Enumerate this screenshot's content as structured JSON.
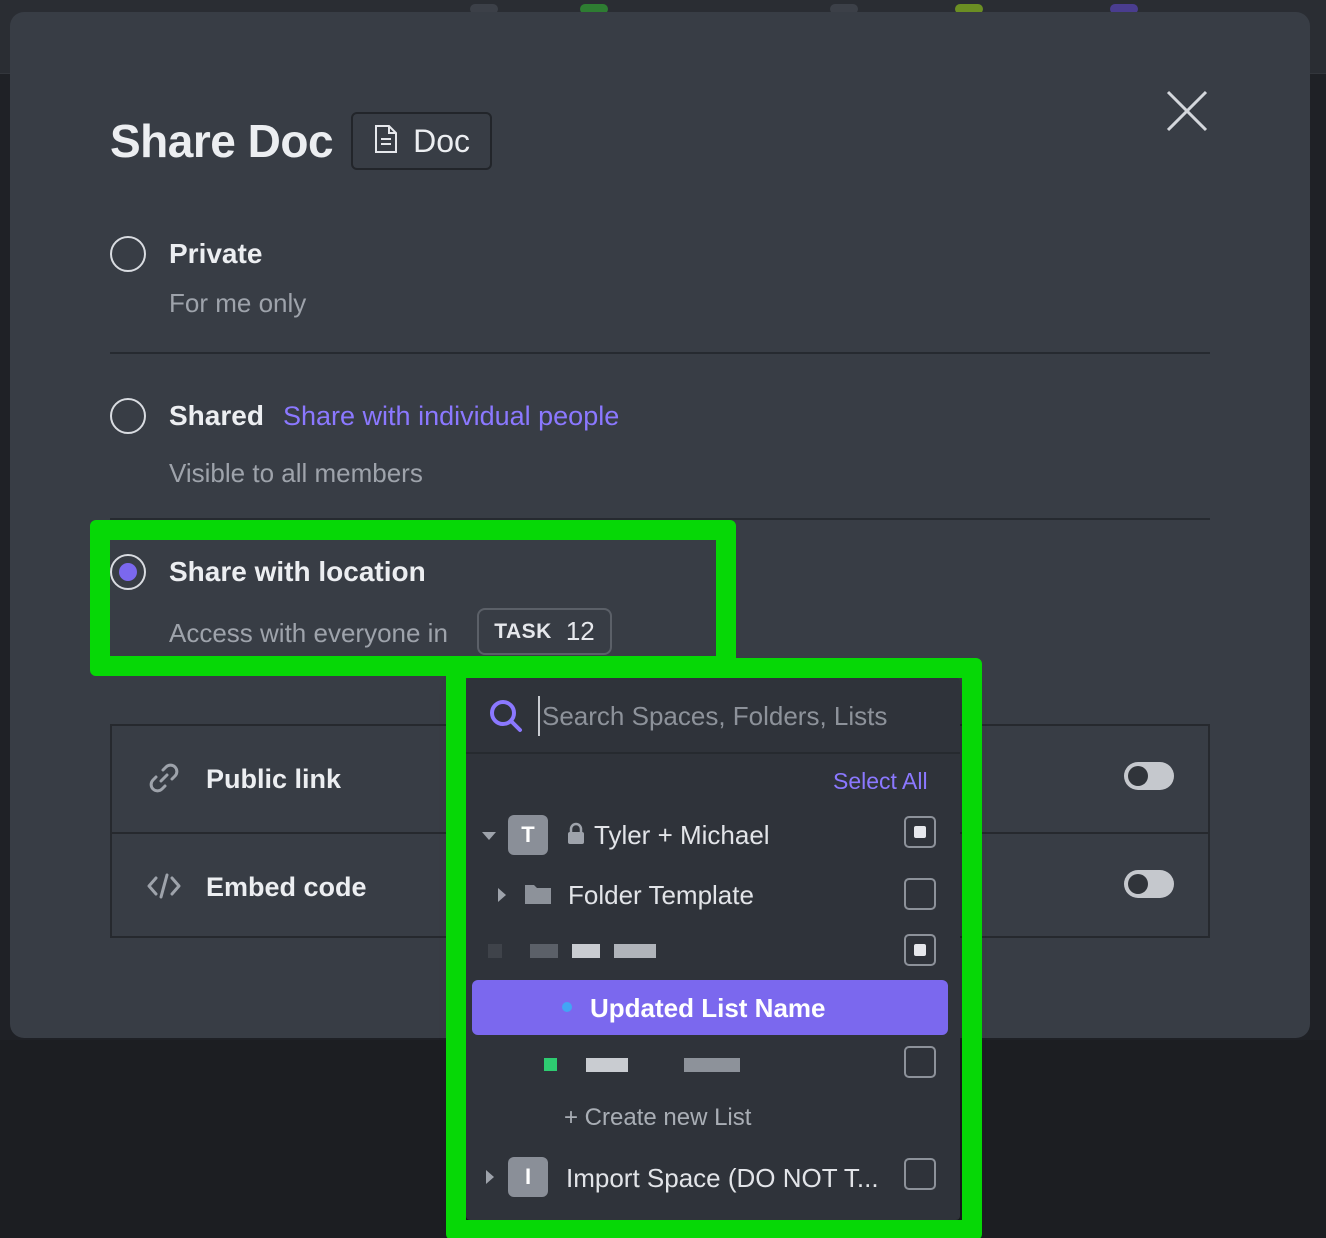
{
  "modal": {
    "title": "Share Doc",
    "doc_badge_label": "Doc"
  },
  "options": {
    "private": {
      "label": "Private",
      "sub": "For me only"
    },
    "shared": {
      "label": "Shared",
      "link": "Share with individual people",
      "sub": "Visible to all members"
    },
    "location": {
      "label": "Share with location",
      "sub": "Access with everyone in",
      "badge_word": "TASK",
      "badge_num": "12"
    }
  },
  "sharing": {
    "public_link": "Public link",
    "embed_code": "Embed code"
  },
  "dropdown": {
    "search_placeholder": "Search Spaces, Folders, Lists",
    "select_all": "Select All",
    "items": [
      {
        "avatar": "T",
        "label": "Tyler + Michael"
      },
      {
        "label": "Folder Template"
      },
      {
        "label": "Updated List Name"
      },
      {
        "label": "+ Create new List"
      },
      {
        "avatar": "I",
        "label": "Import Space (DO NOT T..."
      }
    ]
  },
  "colors": {
    "accent": "#7b68ee",
    "annotation": "#06d806",
    "modal_bg": "#383d45"
  }
}
